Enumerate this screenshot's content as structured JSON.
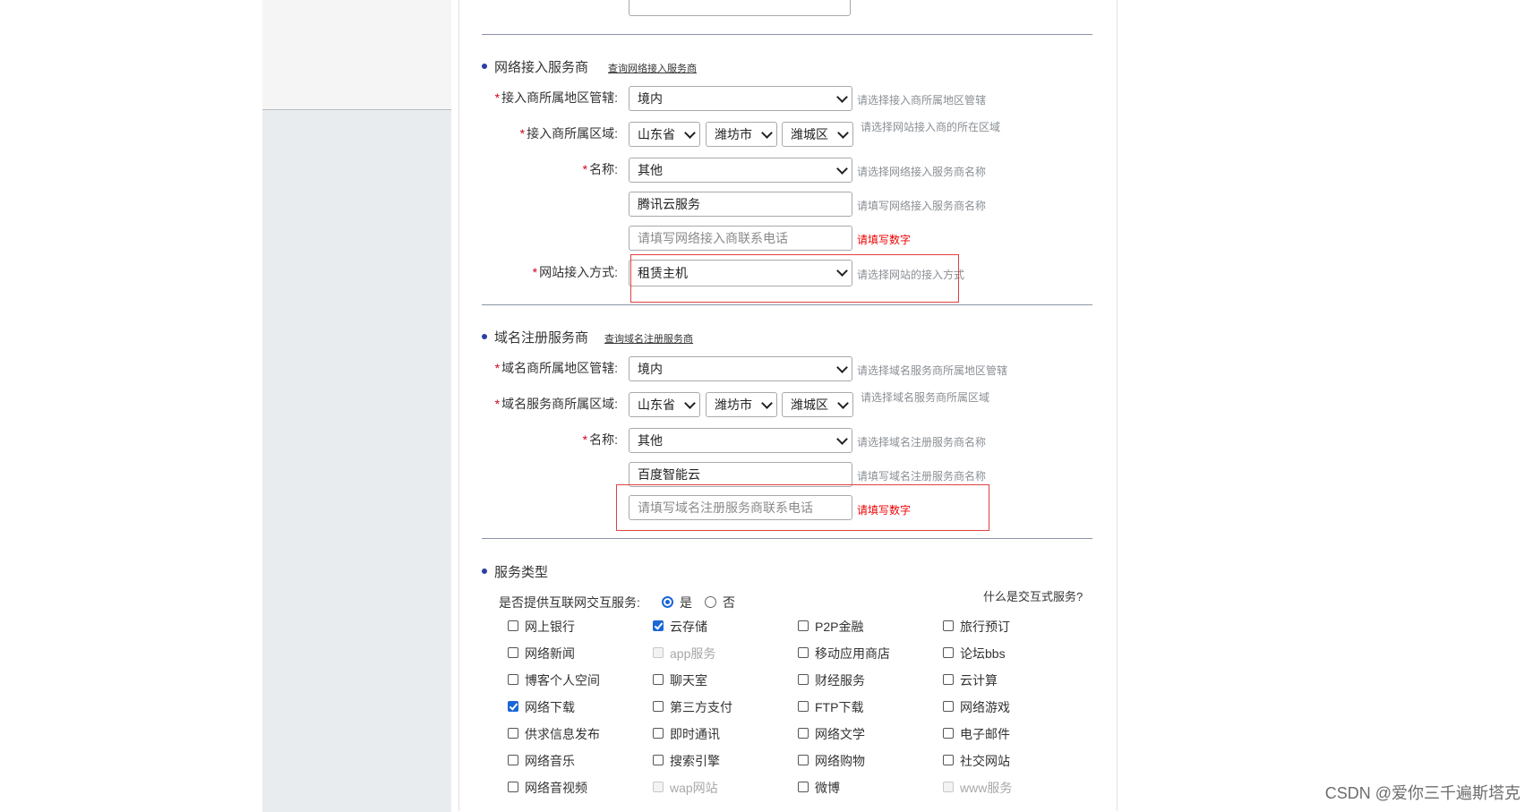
{
  "isp_section": {
    "title": "网络接入服务商",
    "link": "查询网络接入服务商",
    "region_label": "接入商所属地区管辖:",
    "region_value": "境内",
    "region_hint": "请选择接入商所属地区管辖",
    "area_label": "接入商所属区域:",
    "province": "山东省",
    "city": "潍坊市",
    "district": "潍城区",
    "area_hint": "请选择网站接入商的所在区域",
    "name_label": "名称:",
    "name_value": "其他",
    "name_hint": "请选择网络接入服务商名称",
    "custom_name_value": "腾讯云服务",
    "custom_name_hint": "请填写网络接入服务商名称",
    "phone_placeholder": "请填写网络接入商联系电话",
    "phone_error": "请填写数字",
    "access_label": "网站接入方式:",
    "access_value": "租赁主机",
    "access_hint": "请选择网站的接入方式"
  },
  "domain_section": {
    "title": "域名注册服务商",
    "link": "查询域名注册服务商",
    "region_label": "域名商所属地区管辖:",
    "region_value": "境内",
    "region_hint": "请选择域名服务商所属地区管辖",
    "area_label": "域名服务商所属区域:",
    "province": "山东省",
    "city": "潍坊市",
    "district": "潍城区",
    "area_hint": "请选择域名服务商所属区域",
    "name_label": "名称:",
    "name_value": "其他",
    "name_hint": "请选择域名注册服务商名称",
    "custom_name_value": "百度智能云",
    "custom_name_hint": "请填写域名注册服务商名称",
    "phone_placeholder": "请填写域名注册服务商联系电话",
    "phone_error": "请填写数字"
  },
  "service_section": {
    "title": "服务类型",
    "interactive_question": "是否提供互联网交互服务:",
    "yes": "是",
    "no": "否",
    "help_link": "什么是交互式服务?",
    "selected": "是",
    "services": [
      {
        "label": "网上银行",
        "checked": false,
        "disabled": false
      },
      {
        "label": "云存储",
        "checked": true,
        "disabled": false
      },
      {
        "label": "P2P金融",
        "checked": false,
        "disabled": false
      },
      {
        "label": "旅行预订",
        "checked": false,
        "disabled": false
      },
      {
        "label": "网络新闻",
        "checked": false,
        "disabled": false
      },
      {
        "label": "app服务",
        "checked": false,
        "disabled": true
      },
      {
        "label": "移动应用商店",
        "checked": false,
        "disabled": false
      },
      {
        "label": "论坛bbs",
        "checked": false,
        "disabled": false
      },
      {
        "label": "博客个人空间",
        "checked": false,
        "disabled": false
      },
      {
        "label": "聊天室",
        "checked": false,
        "disabled": false
      },
      {
        "label": "财经服务",
        "checked": false,
        "disabled": false
      },
      {
        "label": "云计算",
        "checked": false,
        "disabled": false
      },
      {
        "label": "网络下载",
        "checked": true,
        "disabled": false
      },
      {
        "label": "第三方支付",
        "checked": false,
        "disabled": false
      },
      {
        "label": "FTP下载",
        "checked": false,
        "disabled": false
      },
      {
        "label": "网络游戏",
        "checked": false,
        "disabled": false
      },
      {
        "label": "供求信息发布",
        "checked": false,
        "disabled": false
      },
      {
        "label": "即时通讯",
        "checked": false,
        "disabled": false
      },
      {
        "label": "网络文学",
        "checked": false,
        "disabled": false
      },
      {
        "label": "电子邮件",
        "checked": false,
        "disabled": false
      },
      {
        "label": "网络音乐",
        "checked": false,
        "disabled": false
      },
      {
        "label": "搜索引擎",
        "checked": false,
        "disabled": false
      },
      {
        "label": "网络购物",
        "checked": false,
        "disabled": false
      },
      {
        "label": "社交网站",
        "checked": false,
        "disabled": false
      },
      {
        "label": "网络音视频",
        "checked": false,
        "disabled": false
      },
      {
        "label": "wap网站",
        "checked": false,
        "disabled": true
      },
      {
        "label": "微博",
        "checked": false,
        "disabled": false
      },
      {
        "label": "www服务",
        "checked": false,
        "disabled": true
      }
    ]
  },
  "watermark": "CSDN @爱你三千遍斯塔克"
}
